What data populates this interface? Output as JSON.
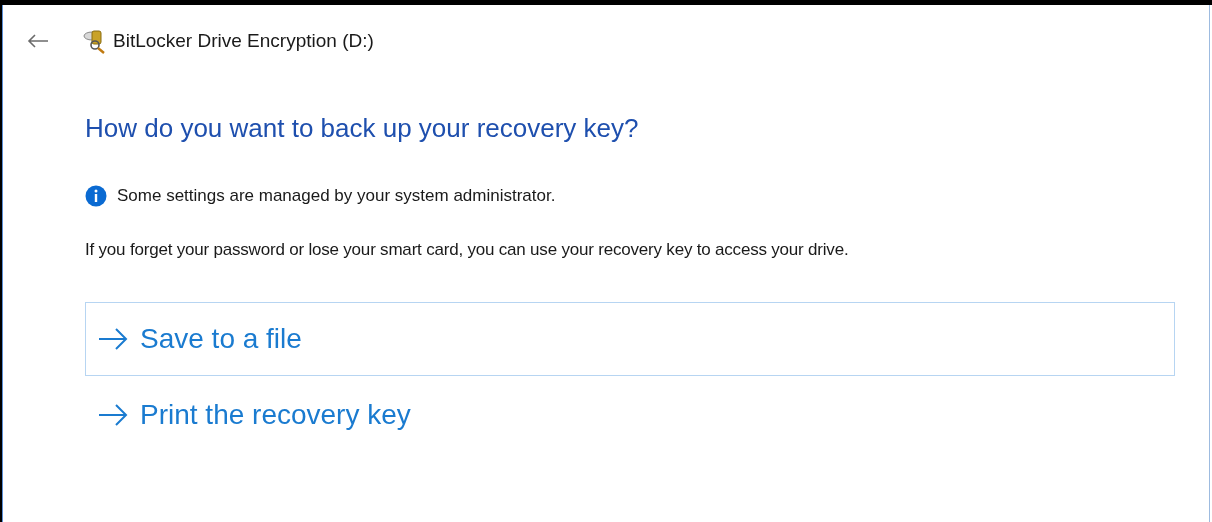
{
  "window": {
    "title": "BitLocker Drive Encryption (D:)"
  },
  "heading": "How do you want to back up your recovery key?",
  "notice": "Some settings are managed by your system administrator.",
  "description": "If you forget your password or lose your smart card, you can use your recovery key to access your drive.",
  "options": [
    {
      "label": "Save to a file",
      "selected": true
    },
    {
      "label": "Print the recovery key",
      "selected": false
    }
  ]
}
